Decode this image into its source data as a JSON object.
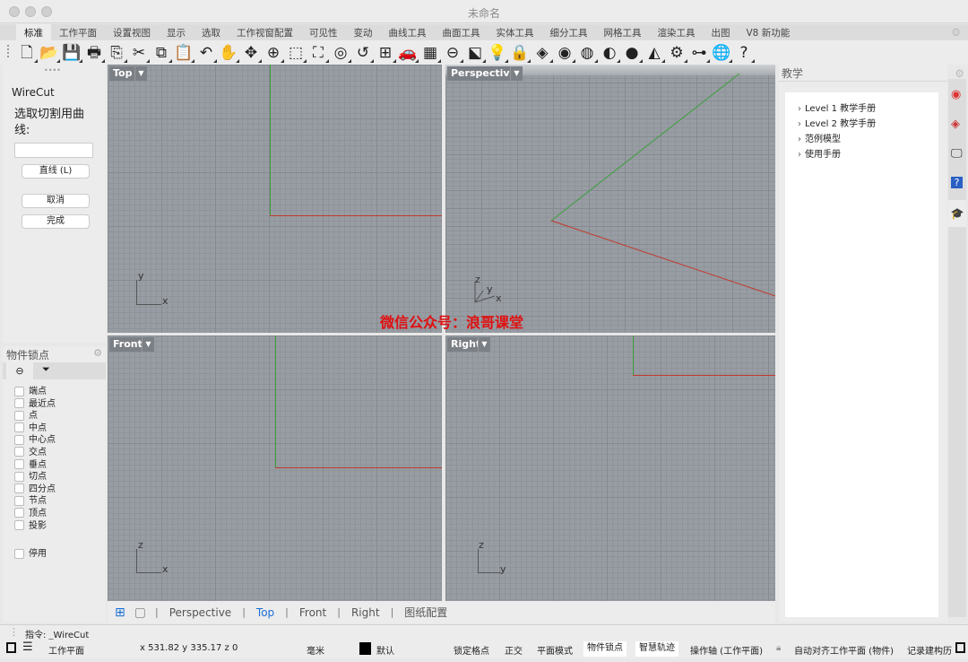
{
  "window": {
    "title": "未命名"
  },
  "tabs": [
    "标准",
    "工作平面",
    "设置视图",
    "显示",
    "选取",
    "工作视窗配置",
    "可见性",
    "变动",
    "曲线工具",
    "曲面工具",
    "实体工具",
    "细分工具",
    "网格工具",
    "渲染工具",
    "出图",
    "V8 新功能"
  ],
  "toolbar": [
    {
      "name": "new-icon",
      "g": "🗋"
    },
    {
      "name": "open-icon",
      "g": "📂"
    },
    {
      "name": "save-icon",
      "g": "💾"
    },
    {
      "name": "print-icon",
      "g": "🖶"
    },
    {
      "name": "import-icon",
      "g": "⎘"
    },
    {
      "name": "cut-icon",
      "g": "✂"
    },
    {
      "name": "copy-icon",
      "g": "⧉"
    },
    {
      "name": "paste-icon",
      "g": "📋"
    },
    {
      "name": "undo-icon",
      "g": "↶"
    },
    {
      "name": "pan-icon",
      "g": "✋"
    },
    {
      "name": "rotate-view-icon",
      "g": "✥"
    },
    {
      "name": "zoom-icon",
      "g": "⊕"
    },
    {
      "name": "zoom-window-icon",
      "g": "⬚"
    },
    {
      "name": "zoom-extents-icon",
      "g": "⛶"
    },
    {
      "name": "zoom-selected-icon",
      "g": "◎"
    },
    {
      "name": "undo-view-icon",
      "g": "↺"
    },
    {
      "name": "viewport-layout-icon",
      "g": "⊞"
    },
    {
      "name": "car-icon",
      "g": "🚗"
    },
    {
      "name": "grid-icon",
      "g": "▦"
    },
    {
      "name": "osnap-icon",
      "g": "⊖"
    },
    {
      "name": "select-icon",
      "g": "⬕"
    },
    {
      "name": "light-icon",
      "g": "💡"
    },
    {
      "name": "lock-icon",
      "g": "🔒"
    },
    {
      "name": "layer-icon",
      "g": "◈"
    },
    {
      "name": "color-wheel-icon",
      "g": "◉"
    },
    {
      "name": "wireframe-sphere-icon",
      "g": "◍"
    },
    {
      "name": "shaded-sphere-icon",
      "g": "◐"
    },
    {
      "name": "render-sphere-icon",
      "g": "●"
    },
    {
      "name": "spotlight-icon",
      "g": "◭"
    },
    {
      "name": "gear-settings-icon",
      "g": "⚙"
    },
    {
      "name": "dimension-icon",
      "g": "⊶"
    },
    {
      "name": "globe-icon",
      "g": "🌐"
    },
    {
      "name": "help-icon",
      "g": "?"
    }
  ],
  "left_panel": {
    "command": "WireCut",
    "prompt": "选取切割用曲线:",
    "input_value": "",
    "buttons": [
      "直线 (L)",
      "取消",
      "完成"
    ]
  },
  "osnap": {
    "title": "物件锁点",
    "items": [
      "端点",
      "最近点",
      "点",
      "中点",
      "中心点",
      "交点",
      "垂点",
      "切点",
      "四分点",
      "节点",
      "顶点",
      "投影"
    ],
    "disable": "停用"
  },
  "viewports": {
    "top": "Top",
    "perspective": "Perspective",
    "front": "Front",
    "right": "Right"
  },
  "axes": {
    "x": "x",
    "y": "y",
    "z": "z"
  },
  "watermark": "微信公众号：浪哥课堂",
  "viewport_tabs": [
    "Perspective",
    "Top",
    "Front",
    "Right",
    "图纸配置"
  ],
  "active_viewport_tab": "Top",
  "right_panel": {
    "title": "教学",
    "items": [
      "Level 1 教学手册",
      "Level 2 教学手册",
      "范例模型",
      "使用手册"
    ]
  },
  "command_line": "指令: _WireCut",
  "status": {
    "cplane": "工作平面",
    "coords": "x 531.82  y 335.17  z 0",
    "units": "毫米",
    "layer": "默认",
    "toggles": [
      "锁定格点",
      "正交",
      "平面模式",
      "物件锁点",
      "智慧轨迹",
      "操作轴 (工作平面)",
      "自动对齐工作平面 (物件)",
      "记录建构历"
    ],
    "active": [
      "物件锁点",
      "智慧轨迹"
    ]
  },
  "colors": {
    "x_axis": "#c0392b",
    "y_axis": "#3aa03a",
    "watermark": "#e01010",
    "active_tab": "#1a6fd6"
  }
}
